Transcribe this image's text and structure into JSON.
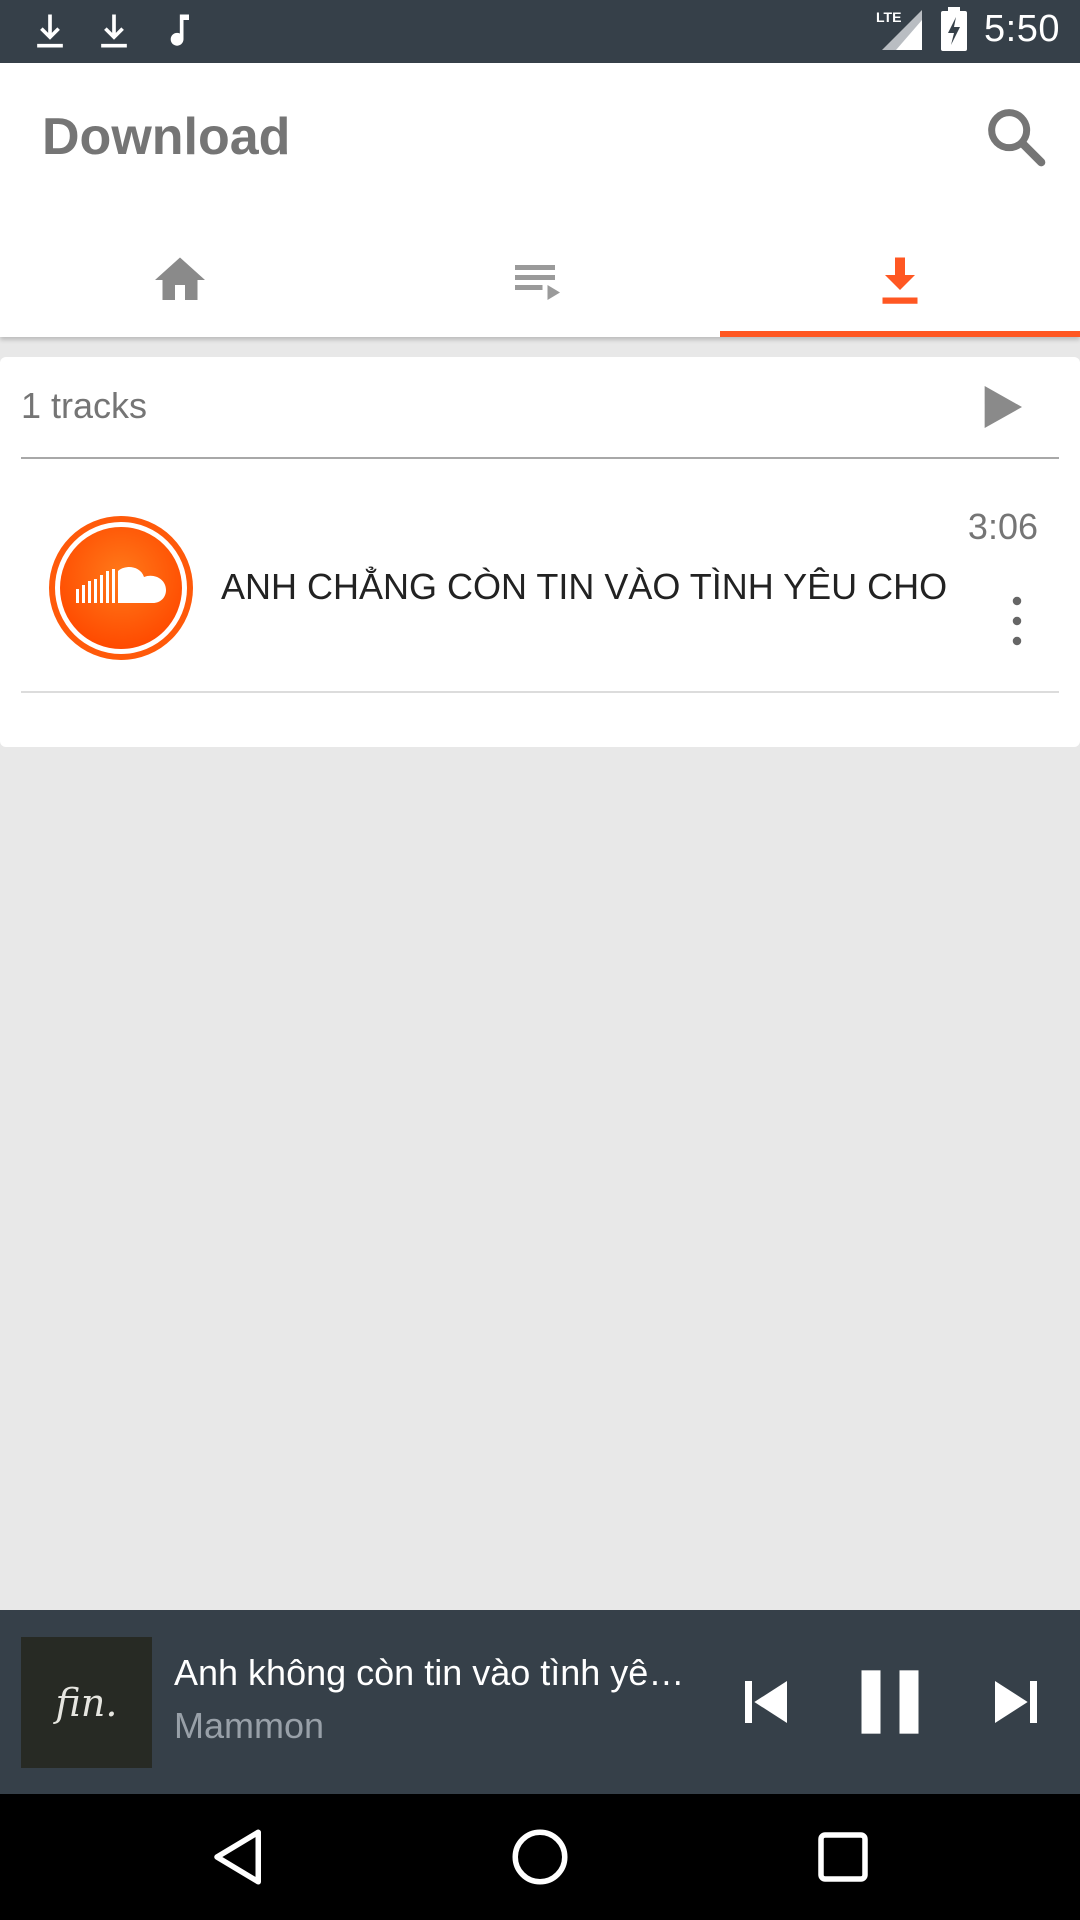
{
  "status_bar": {
    "time": "5:50",
    "network": "LTE",
    "notification_icons": [
      "download-icon",
      "download-icon",
      "music-note-icon"
    ],
    "system_icons": [
      "signal-icon",
      "battery-charging-icon"
    ]
  },
  "app_bar": {
    "title": "Download",
    "search_icon": "search-icon",
    "tabs": [
      {
        "icon": "home-icon",
        "active": false
      },
      {
        "icon": "playlist-icon",
        "active": false
      },
      {
        "icon": "download-icon",
        "active": true
      }
    ]
  },
  "track_list": {
    "count_label": "1 tracks",
    "play_all_icon": "play-icon",
    "tracks": [
      {
        "title": "ANH CHẲNG CÒN TIN VÀO TÌNH YÊU CHO",
        "duration": "3:06",
        "artwork_icon": "soundcloud-icon",
        "menu_icon": "more-vert-icon"
      }
    ]
  },
  "mini_player": {
    "art_text": "fin.",
    "title": "Anh không còn tin vào tình yêu cho Em - Mammon",
    "artist": "Mammon",
    "controls": [
      "skip-previous-icon",
      "pause-icon",
      "skip-next-icon"
    ]
  },
  "colors": {
    "accent": "#ff5722",
    "status_bar": "#364049",
    "player_bg": "#364049",
    "content_bg": "#e8e8e8"
  }
}
